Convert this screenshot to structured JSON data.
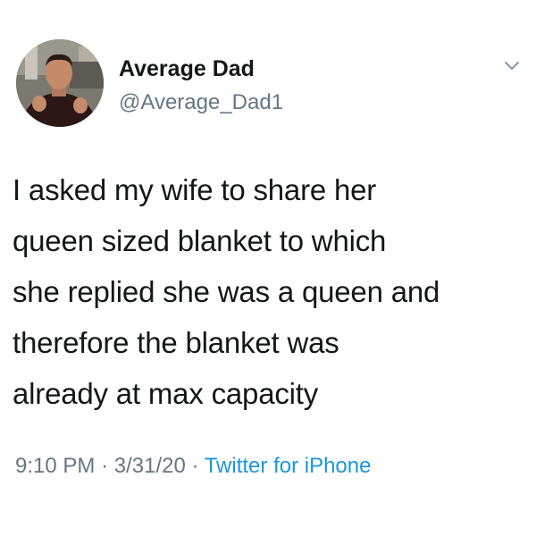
{
  "user": {
    "display_name": "Average Dad",
    "handle": "@Average_Dad1",
    "avatar_icon": "profile-photo"
  },
  "tweet": {
    "text_lines": [
      "I asked my wife to share her",
      "queen sized blanket to which",
      "she replied she was a queen and",
      "therefore the blanket was",
      "already at max capacity"
    ],
    "time": "9:10 PM",
    "separator": "·",
    "date": "3/31/20",
    "source": "Twitter for iPhone"
  },
  "colors": {
    "text": "#14171a",
    "secondary": "#657786",
    "link": "#1b95e0",
    "background": "#ffffff"
  },
  "menu_icon": "chevron-down-icon"
}
